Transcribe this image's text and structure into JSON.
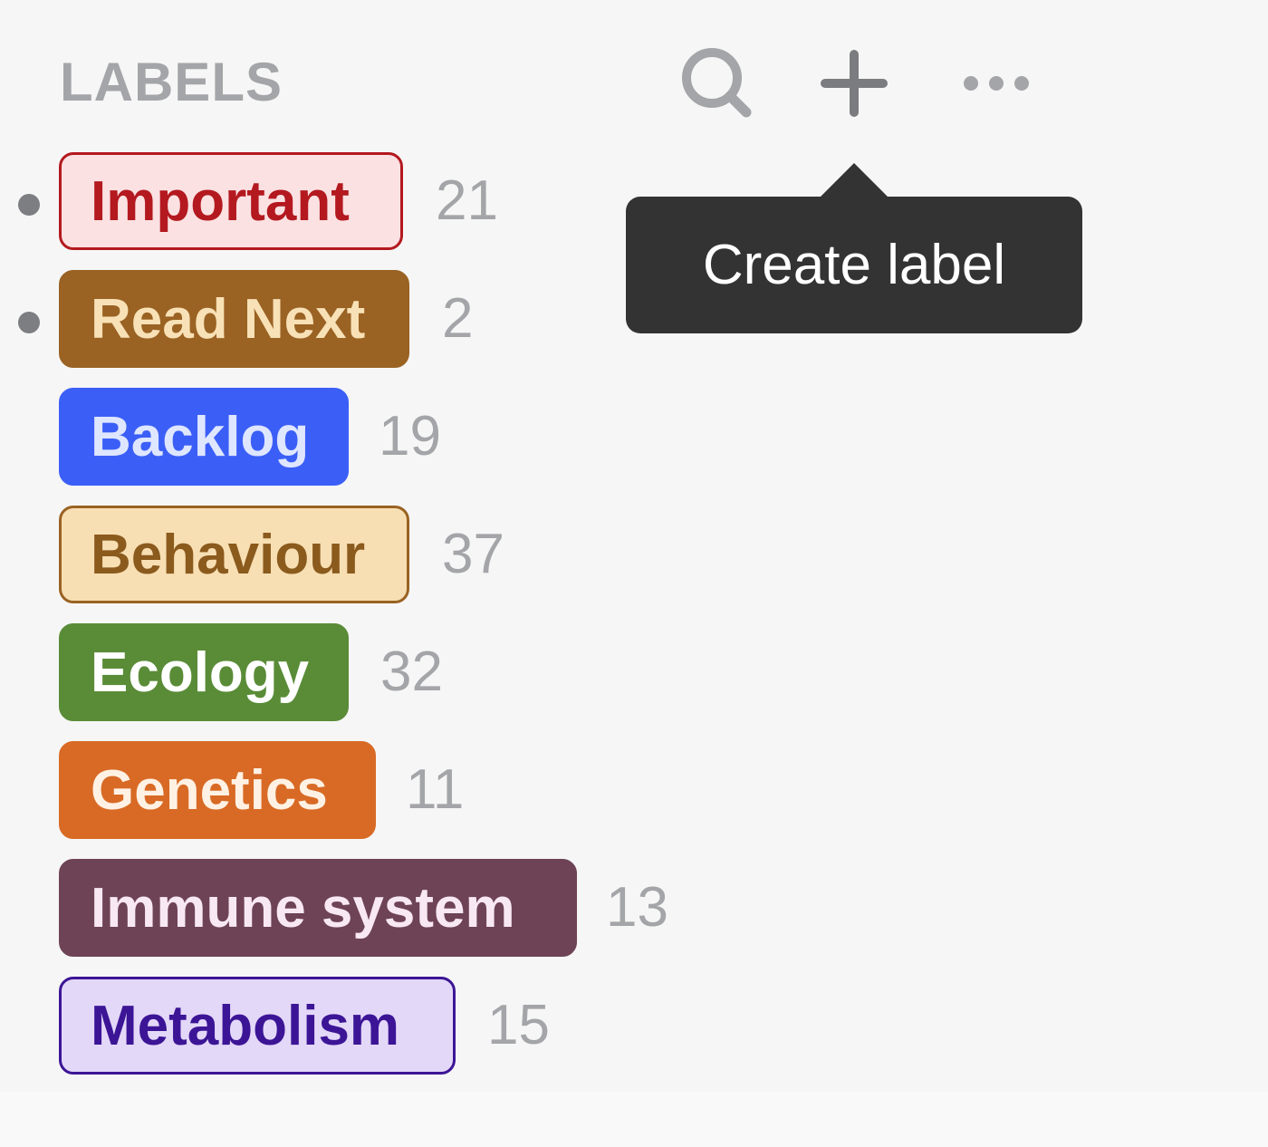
{
  "header": {
    "title": "LABELS",
    "icons": {
      "search": "search-icon",
      "add": "plus-icon",
      "more": "more-horizontal-icon"
    }
  },
  "tooltip": {
    "text": "Create label"
  },
  "labels": [
    {
      "name": "Important",
      "count": "21",
      "unread": true,
      "bg": "#fbe1e2",
      "text": "#b3191f",
      "border": "#b3191f"
    },
    {
      "name": "Read Next",
      "count": "2",
      "unread": true,
      "bg": "#9a6223",
      "text": "#f8e1b7",
      "border": "#9a6223"
    },
    {
      "name": "Backlog",
      "count": "19",
      "unread": false,
      "bg": "#3b5ff6",
      "text": "#dfe6ff",
      "border": "#3b5ff6"
    },
    {
      "name": "Behaviour",
      "count": "37",
      "unread": false,
      "bg": "#f7dfb3",
      "text": "#8b5a1d",
      "border": "#9a6223"
    },
    {
      "name": "Ecology",
      "count": "32",
      "unread": false,
      "bg": "#5a8c37",
      "text": "#ffffff",
      "border": "#5a8c37"
    },
    {
      "name": "Genetics",
      "count": "11",
      "unread": false,
      "bg": "#d86a25",
      "text": "#fff1e3",
      "border": "#d86a25"
    },
    {
      "name": "Immune system",
      "count": "13",
      "unread": false,
      "bg": "#6e4356",
      "text": "#f8e8f4",
      "border": "#6e4356"
    },
    {
      "name": "Metabolism",
      "count": "15",
      "unread": false,
      "bg": "#e3d8f8",
      "text": "#3c1596",
      "border": "#3c1596"
    }
  ]
}
